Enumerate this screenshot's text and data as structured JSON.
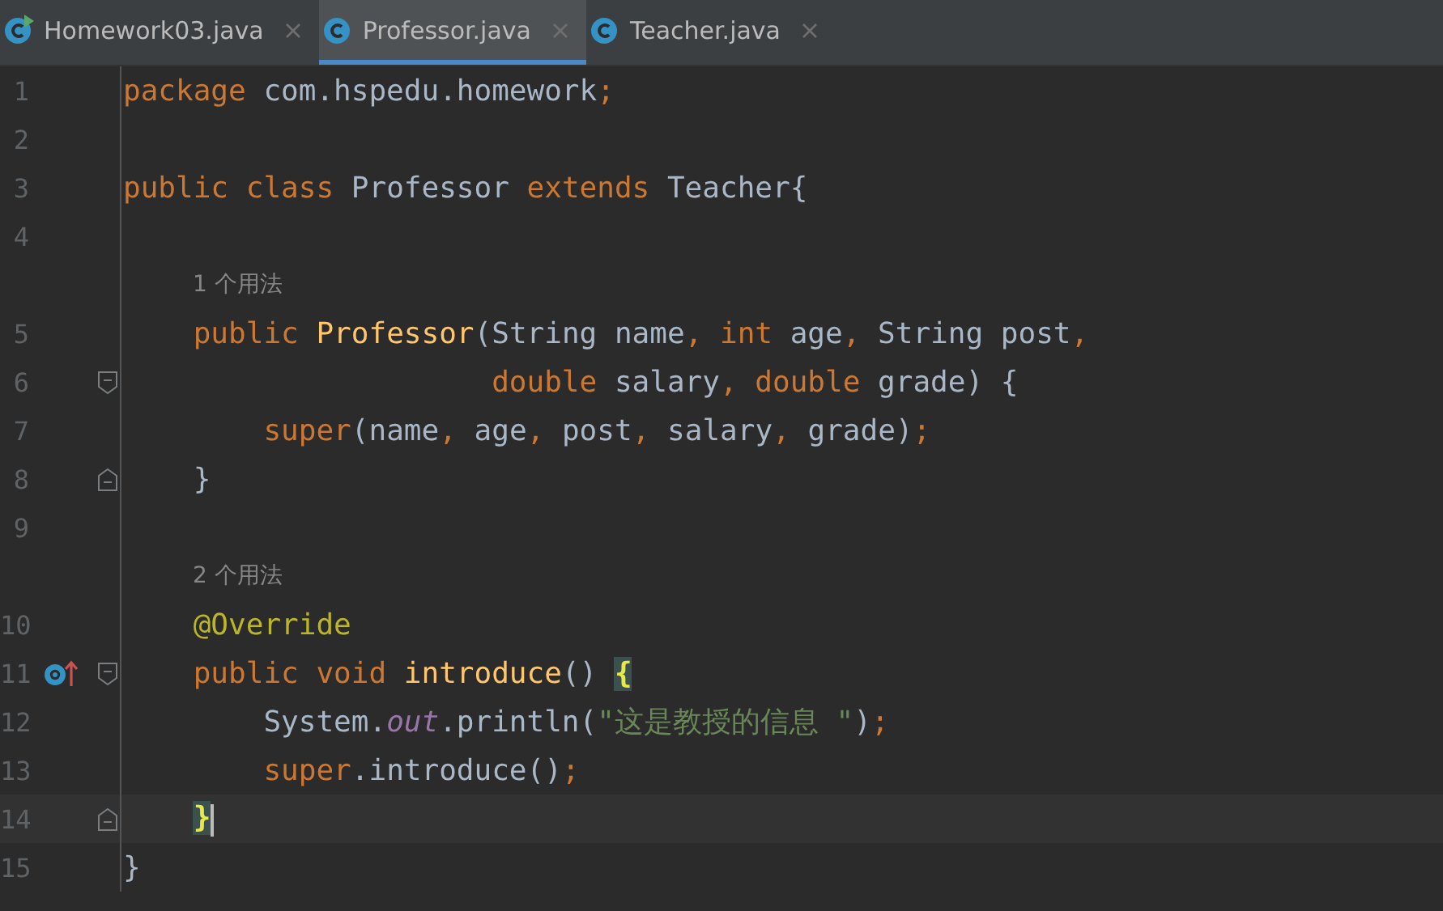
{
  "tabs": [
    {
      "label": "Homework03.java",
      "selected": false,
      "runnable": true
    },
    {
      "label": "Professor.java",
      "selected": true,
      "runnable": false
    },
    {
      "label": "Teacher.java",
      "selected": false,
      "runnable": false
    }
  ],
  "lines": [
    {
      "kind": "code",
      "number": "1",
      "tokens": [
        {
          "kind": "kw",
          "text": "package"
        },
        {
          "kind": "plain",
          "text": " com.hspedu.homework"
        },
        {
          "kind": "kw",
          "text": ";"
        }
      ]
    },
    {
      "kind": "code",
      "number": "2"
    },
    {
      "kind": "code",
      "number": "3",
      "tokens": [
        {
          "kind": "kw",
          "text": "public class "
        },
        {
          "kind": "plain",
          "text": "Professor "
        },
        {
          "kind": "kw",
          "text": "extends "
        },
        {
          "kind": "plain",
          "text": "Teacher{"
        }
      ]
    },
    {
      "kind": "code",
      "number": "4"
    },
    {
      "kind": "hint",
      "text": "1 个用法"
    },
    {
      "kind": "code",
      "number": "5",
      "tokens": [
        {
          "kind": "kw",
          "text": "    public "
        },
        {
          "kind": "method",
          "text": "Professor"
        },
        {
          "kind": "plain",
          "text": "(String name"
        },
        {
          "kind": "kw",
          "text": ", int "
        },
        {
          "kind": "plain",
          "text": "age"
        },
        {
          "kind": "kw",
          "text": ", "
        },
        {
          "kind": "plain",
          "text": "String post"
        },
        {
          "kind": "kw",
          "text": ","
        }
      ]
    },
    {
      "kind": "code",
      "number": "6",
      "fold_open": true,
      "tokens": [
        {
          "kind": "kw",
          "text": "                     double "
        },
        {
          "kind": "plain",
          "text": "salary"
        },
        {
          "kind": "kw",
          "text": ", double "
        },
        {
          "kind": "plain",
          "text": "grade) {"
        }
      ]
    },
    {
      "kind": "code",
      "number": "7",
      "tokens": [
        {
          "kind": "kw",
          "text": "        super"
        },
        {
          "kind": "plain",
          "text": "(name"
        },
        {
          "kind": "kw",
          "text": ", "
        },
        {
          "kind": "plain",
          "text": "age"
        },
        {
          "kind": "kw",
          "text": ", "
        },
        {
          "kind": "plain",
          "text": "post"
        },
        {
          "kind": "kw",
          "text": ", "
        },
        {
          "kind": "plain",
          "text": "salary"
        },
        {
          "kind": "kw",
          "text": ", "
        },
        {
          "kind": "plain",
          "text": "grade)"
        },
        {
          "kind": "kw",
          "text": ";"
        }
      ]
    },
    {
      "kind": "code",
      "number": "8",
      "fold_close": true,
      "tokens": [
        {
          "kind": "plain",
          "text": "    }"
        }
      ]
    },
    {
      "kind": "code",
      "number": "9"
    },
    {
      "kind": "hint",
      "text": "2 个用法"
    },
    {
      "kind": "code",
      "number": "10",
      "tokens": [
        {
          "kind": "annotation",
          "text": "    @Override"
        }
      ]
    },
    {
      "kind": "code",
      "number": "11",
      "fold_open": true,
      "override": true,
      "tokens": [
        {
          "kind": "kw",
          "text": "    public void "
        },
        {
          "kind": "method",
          "text": "introduce"
        },
        {
          "kind": "plain",
          "text": "() "
        },
        {
          "kind": "brace",
          "text": "{"
        }
      ]
    },
    {
      "kind": "code",
      "number": "12",
      "tokens": [
        {
          "kind": "plain",
          "text": "        System."
        },
        {
          "kind": "field",
          "text": "out"
        },
        {
          "kind": "plain",
          "text": ".println("
        },
        {
          "kind": "string",
          "text": "\"这是教授的信息 \""
        },
        {
          "kind": "plain",
          "text": ")"
        },
        {
          "kind": "kw",
          "text": ";"
        }
      ]
    },
    {
      "kind": "code",
      "number": "13",
      "tokens": [
        {
          "kind": "kw",
          "text": "        super"
        },
        {
          "kind": "plain",
          "text": ".introduce()"
        },
        {
          "kind": "kw",
          "text": ";"
        }
      ]
    },
    {
      "kind": "code",
      "number": "14",
      "fold_close": true,
      "current": true,
      "tokens": [
        {
          "kind": "brace",
          "text": "    }"
        }
      ]
    },
    {
      "kind": "code",
      "number": "15",
      "tokens": [
        {
          "kind": "plain",
          "text": "}"
        }
      ]
    }
  ]
}
